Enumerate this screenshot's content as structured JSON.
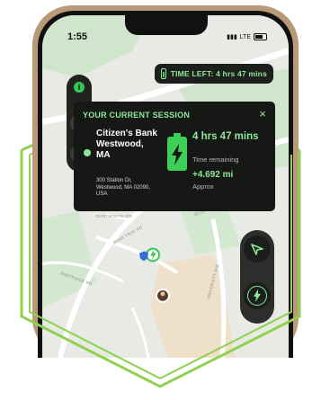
{
  "status_bar": {
    "time": "1:55",
    "network": "LTE"
  },
  "time_left_pill": {
    "label": "TIME LEFT: 4 hrs 47 mins"
  },
  "left_controls": {
    "info_label": "i"
  },
  "session_card": {
    "title": "YOUR CURRENT SESSION",
    "close_label": "×",
    "location_name": "Citizen's Bank Westwood, MA",
    "address": "300 Station Dr, Westwood, MA 02090, USA",
    "time_remaining_value": "4 hrs 47 mins",
    "time_remaining_label": "Time remaining",
    "distance_value": "+4.692 mi",
    "distance_label": "Approx"
  },
  "map": {
    "street_labels": [
      "DARTMOUTH DR",
      "BEAR TREE RD",
      "PARTRIDGE RD",
      "UNIVERSITY AVE",
      "BLUE HILL DR"
    ]
  },
  "right_controls": [
    "navigate-button",
    "charge-button"
  ],
  "colors": {
    "accent": "#8ee89a",
    "accent_strong": "#3ecf58",
    "dark_panel": "#161816",
    "hexagon": "#8fd14f"
  }
}
